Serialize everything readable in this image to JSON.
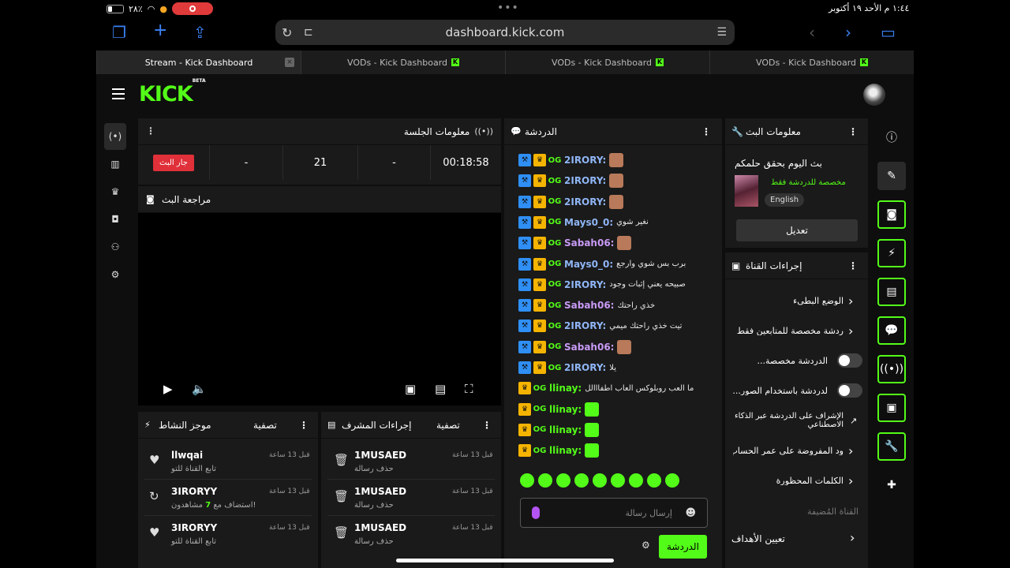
{
  "status_bar": {
    "time": "١:٤٤ م  الأحد ١٩ أكتوبر",
    "battery": "٢٨٪"
  },
  "browser": {
    "url": "dashboard.kick.com"
  },
  "tabs": [
    {
      "label": "Stream - Kick Dashboard"
    },
    {
      "label": "VODs - Kick Dashboard"
    },
    {
      "label": "VODs - Kick Dashboard"
    },
    {
      "label": "VODs - Kick Dashboard"
    }
  ],
  "brand": {
    "logo": "KICK",
    "beta": "BETA"
  },
  "session": {
    "title": "معلومات الجلسة",
    "live_label": "جار البث",
    "dash1": "-",
    "followers": "21",
    "dash2": "-",
    "duration": "00:18:58"
  },
  "preview": {
    "title": "مراجعة البث"
  },
  "activity": {
    "title": "موجز النشاط",
    "filter": "تصفية",
    "items": [
      {
        "name": "llwqai",
        "sub": "تابع القناة للتو",
        "time": "قبل 13 ساعة",
        "icon": "♥"
      },
      {
        "name": "3IRORYY",
        "sub_pre": "استضاف مع ",
        "sub_num": "7",
        "sub_post": " مشاهدون!",
        "time": "قبل 13 ساعة",
        "icon": "↻"
      },
      {
        "name": "3IRORYY",
        "sub": "تابع القناة للتو",
        "time": "قبل 13 ساعة",
        "icon": "♥"
      }
    ]
  },
  "moderator": {
    "title": "إجراءات المشرف",
    "filter": "تصفية",
    "items": [
      {
        "name": "1MUSAED",
        "sub": "حذف رسالة",
        "time": "قبل 13 ساعة"
      },
      {
        "name": "1MUSAED",
        "sub": "حذف رسالة",
        "time": "قبل 13 ساعة"
      },
      {
        "name": "1MUSAED",
        "sub": "حذف رسالة",
        "time": "قبل 13 ساعة"
      }
    ]
  },
  "chat": {
    "title": "الدردشة",
    "messages": [
      {
        "user": "2IRORY:",
        "msg": "",
        "color": "#8fb5f5",
        "badges": 3
      },
      {
        "user": "2IRORY:",
        "msg": "",
        "color": "#8fb5f5",
        "badges": 3
      },
      {
        "user": "2IRORY:",
        "msg": "",
        "color": "#8fb5f5",
        "badges": 3
      },
      {
        "user": "Mays0_0:",
        "msg": "نغير شوي",
        "color": "#8fb5f5",
        "badges": 3
      },
      {
        "user": "Sabah06:",
        "msg": "",
        "color": "#c89af5",
        "badges": 3
      },
      {
        "user": "Mays0_0:",
        "msg": "برب بس شوي وارجع",
        "color": "#8fb5f5",
        "badges": 3
      },
      {
        "user": "2IRORY:",
        "msg": "صبيحه يعني إثبات وجود",
        "color": "#8fb5f5",
        "badges": 3
      },
      {
        "user": "Sabah06:",
        "msg": "خذي راحتك",
        "color": "#c89af5",
        "badges": 3
      },
      {
        "user": "2IRORY:",
        "msg": "تيت خذي راحتك ميمي",
        "color": "#8fb5f5",
        "badges": 3
      },
      {
        "user": "Sabah06:",
        "msg": "",
        "color": "#c89af5",
        "badges": 3
      },
      {
        "user": "2IRORY:",
        "msg": "يلا",
        "color": "#8fb5f5",
        "badges": 3
      },
      {
        "user": "llinay:",
        "msg": "ما العب روبلوكس العاب اطفااالل",
        "color": "#53fc18",
        "badges": 2
      },
      {
        "user": "llinay:",
        "msg": "",
        "color": "#53fc18",
        "badges": 2
      },
      {
        "user": "llinay:",
        "msg": "",
        "color": "#53fc18",
        "badges": 2
      },
      {
        "user": "llinay:",
        "msg": "",
        "color": "#53fc18",
        "badges": 2
      }
    ],
    "input_placeholder": "إرسال رسالة",
    "send_label": "الدردشة"
  },
  "stream_info": {
    "title": "معلومات البث",
    "stream_title": "بث اليوم بحقق حلمكم",
    "category": "مخصصة للدردشة فقط",
    "language": "English",
    "edit": "تعديل"
  },
  "channel_actions": {
    "title": "إجراءات القناة",
    "rows": [
      {
        "label": "الوضع البطيء",
        "type": "arrow"
      },
      {
        "label": "ردشة مخصصة للمتابعين فقط",
        "type": "arrow"
      },
      {
        "label": "الدردشة مخصصة...",
        "type": "toggle"
      },
      {
        "label": "لدردشة باستخدام الصور...",
        "type": "toggle"
      },
      {
        "label": "الإشراف على الدردشة عبر الذكاء الاصطناعي",
        "type": "ext"
      },
      {
        "label": "ود المفروضة على عمر الحساب",
        "type": "arrow"
      },
      {
        "label": "الكلمات المحظورة",
        "type": "arrow"
      }
    ],
    "section": "القناة المُضيفة",
    "goals": "تعيين الأهداف"
  },
  "colors": {
    "accent": "#53fc18",
    "live": "#e0303a",
    "bg": "#0e0e0e",
    "panel": "#1a1a1a"
  }
}
